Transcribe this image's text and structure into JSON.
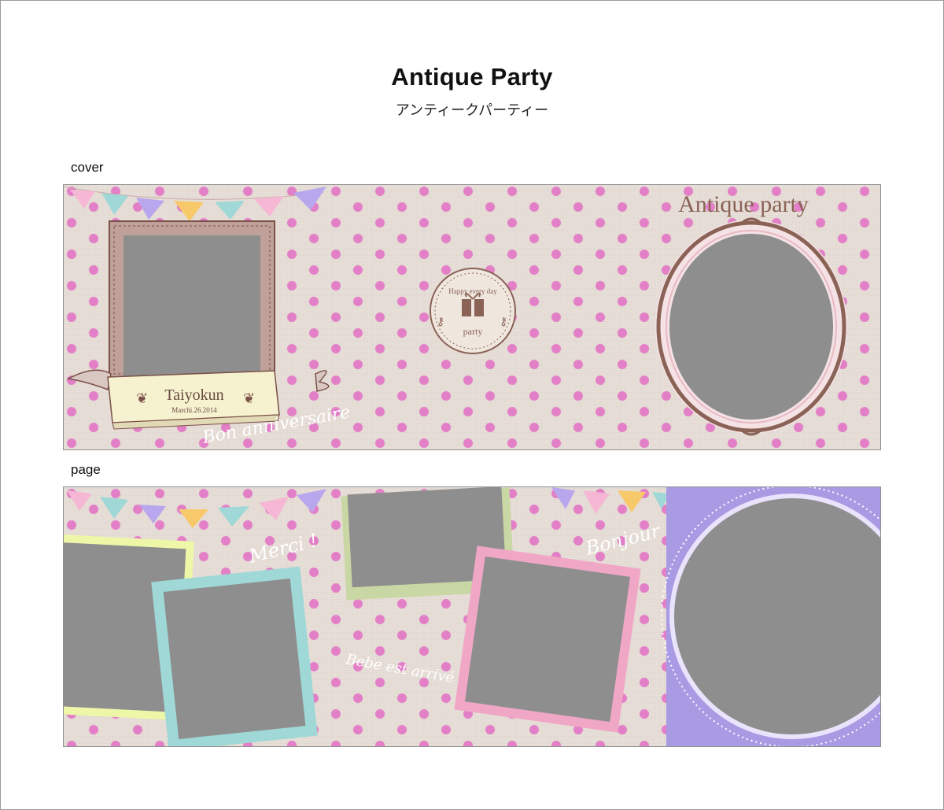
{
  "page": {
    "title": "Antique Party",
    "subtitle": "アンティークパーティー"
  },
  "sections": {
    "cover_label": "cover",
    "page_label": "page"
  },
  "cover": {
    "heading": "Antique party",
    "name_banner": {
      "name": "Taiyokun",
      "date": "Marchi.26.2014"
    },
    "emblem": {
      "arc_text": "Happy every day",
      "center_text": "party"
    },
    "script_text": "Bon anniversaire"
  },
  "page_spread": {
    "script_merci": "Merci !",
    "script_bonjour": "Bonjour",
    "script_bebe": "Bebe est arrivé"
  },
  "colors": {
    "paper": "#e6ddd6",
    "dot": "#e27fc7",
    "photo": "#8e8e8e",
    "brown": "#8a6256",
    "frame_yellow": "#eef7a8",
    "frame_teal": "#9fd8d6",
    "frame_green": "#c9d7a4",
    "frame_pink": "#f0a7c6",
    "frame_lavender": "#a99ae4"
  }
}
